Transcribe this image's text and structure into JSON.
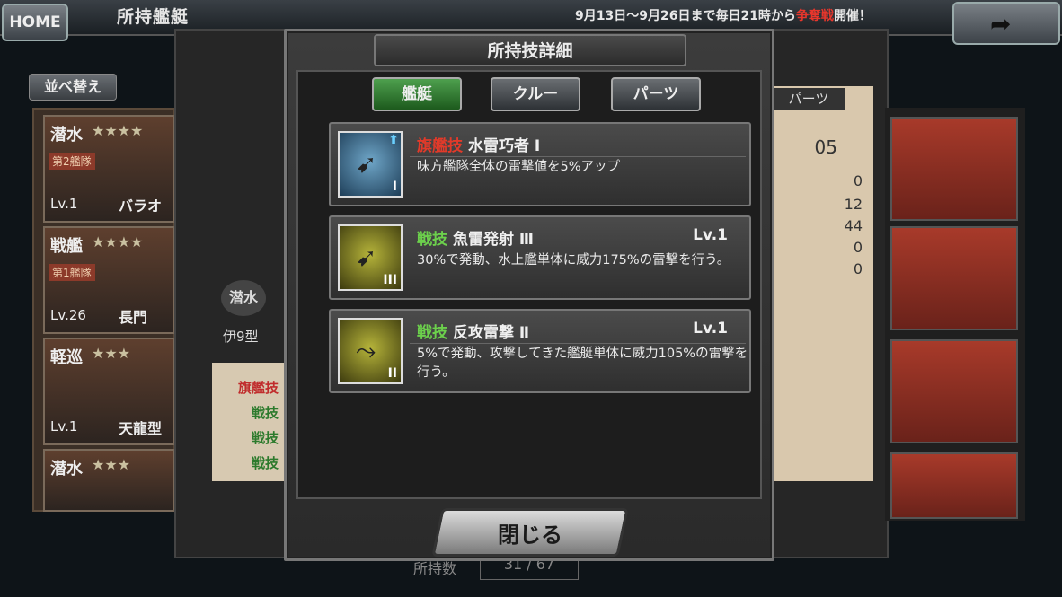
{
  "topbar": {
    "home": "HOME",
    "title": "所持艦艇",
    "notice_pre": "9月13日〜9月26日まで毎日21時から",
    "notice_event": "争奪戦",
    "notice_post": "開催！",
    "back_icon": "back-arrow-icon"
  },
  "background": {
    "sort_label": "並べ替え",
    "parts_label": "パーツ",
    "cards": [
      {
        "type": "潜水",
        "stars": "★★★★",
        "fleet": "第2艦隊",
        "level": "Lv.1",
        "name": "バラオ"
      },
      {
        "type": "戦艦",
        "stars": "★★★★",
        "fleet": "第1艦隊",
        "level": "Lv.26",
        "name": "長門"
      },
      {
        "type": "軽巡",
        "stars": "★★★",
        "fleet": "",
        "level": "Lv.1",
        "name": "天龍型"
      },
      {
        "type": "潜水",
        "stars": "★★★",
        "fleet": "",
        "level": "",
        "name": ""
      }
    ],
    "ship_type": "潜水",
    "ship_name": "伊9型",
    "stat_top": "05",
    "stats": [
      "0",
      "12",
      "44",
      "0",
      "0"
    ],
    "skill_list": [
      "旗艦技",
      "戦技",
      "戦技",
      "戦技"
    ],
    "count_label": "所持数",
    "count_value": "31 / 67"
  },
  "modal": {
    "title": "所持技詳細",
    "tabs": [
      "艦艇",
      "クルー",
      "パーツ"
    ],
    "active_tab": 0,
    "skills": [
      {
        "category": "旗艦技",
        "name": "水雷巧者 Ⅰ",
        "level": "",
        "description": "味方艦隊全体の雷撃値を5%アップ",
        "rank": "I",
        "icon": "torpedo-blue-icon"
      },
      {
        "category": "戦技",
        "name": "魚雷発射 Ⅲ",
        "level": "Lv.1",
        "description": "30%で発動、水上艦単体に威力175%の雷撃を行う。",
        "rank": "III",
        "icon": "torpedo-gold-icon"
      },
      {
        "category": "戦技",
        "name": "反攻雷撃 Ⅱ",
        "level": "Lv.1",
        "description": "5%で発動、攻撃してきた艦艇単体に威力105%の雷撃を行う。",
        "rank": "II",
        "icon": "counter-torpedo-icon"
      }
    ],
    "close_label": "閉じる"
  },
  "colors": {
    "flagship_skill": "#e23a2a",
    "battle_skill": "#6cd04c",
    "event_red": "#e8362c",
    "active_tab": "#3a8a3a"
  }
}
